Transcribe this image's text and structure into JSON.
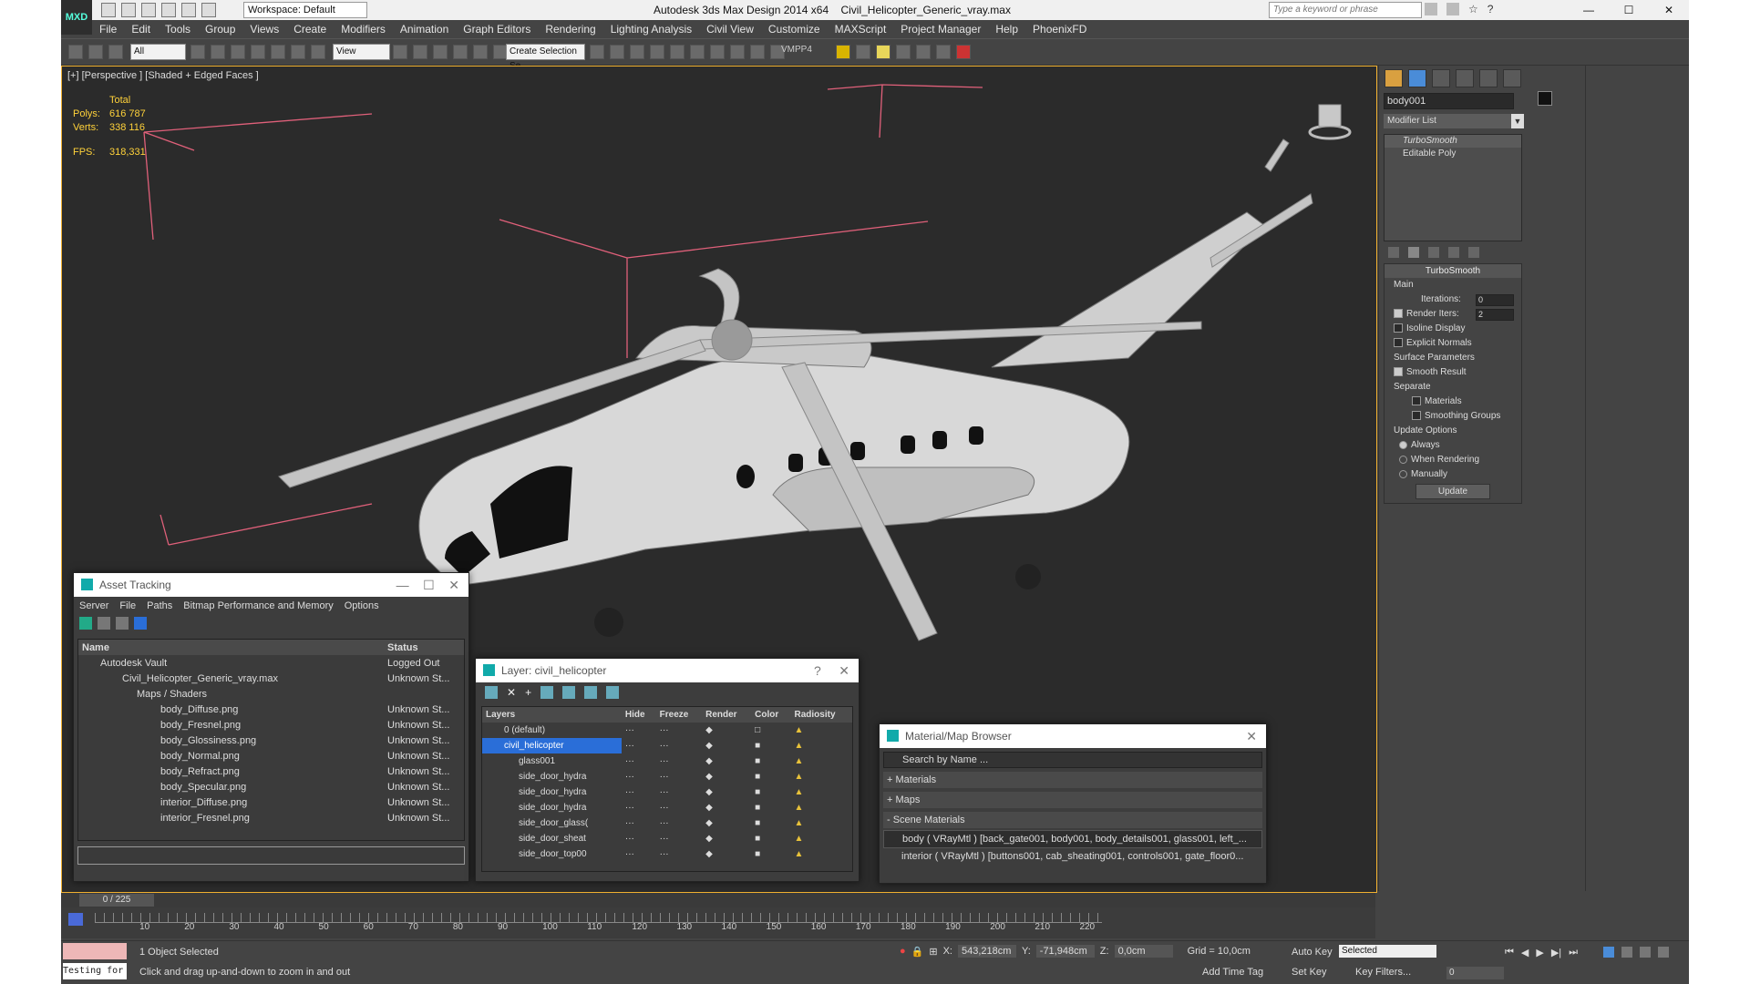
{
  "titlebar": {
    "workspace": "Workspace: Default",
    "app_title": "Autodesk 3ds Max Design 2014 x64",
    "file_name": "Civil_Helicopter_Generic_vray.max",
    "search_placeholder": "Type a keyword or phrase",
    "logo": "MXD"
  },
  "menu": [
    "File",
    "Edit",
    "Tools",
    "Group",
    "Views",
    "Create",
    "Modifiers",
    "Animation",
    "Graph Editors",
    "Rendering",
    "Lighting Analysis",
    "Civil View",
    "Customize",
    "MAXScript",
    "Project Manager",
    "Help",
    "PhoenixFD"
  ],
  "toolbar": {
    "filter": "All",
    "ref_coord": "View",
    "selection_set": "Create Selection Se",
    "vmpp": "VMPP4"
  },
  "viewport": {
    "label": "[+] [Perspective ] [Shaded + Edged Faces ]",
    "stats_header": "Total",
    "polys_label": "Polys:",
    "polys": "616 787",
    "verts_label": "Verts:",
    "verts": "338 116",
    "fps_label": "FPS:",
    "fps": "318,331"
  },
  "command_panel": {
    "object_name": "body001",
    "modifier_list": "Modifier List",
    "stack": [
      "TurboSmooth",
      "Editable Poly"
    ],
    "rollout_title": "TurboSmooth",
    "main_label": "Main",
    "iterations_label": "Iterations:",
    "iterations": "0",
    "render_iters_label": "Render Iters:",
    "render_iters": "2",
    "isoline": "Isoline Display",
    "explicit_normals": "Explicit Normals",
    "surface_params": "Surface Parameters",
    "smooth_result": "Smooth Result",
    "separate": "Separate",
    "materials": "Materials",
    "smoothing_groups": "Smoothing Groups",
    "update_options": "Update Options",
    "always": "Always",
    "when_rendering": "When Rendering",
    "manually": "Manually",
    "update_btn": "Update"
  },
  "asset_tracking": {
    "title": "Asset Tracking",
    "menu": [
      "Server",
      "File",
      "Paths",
      "Bitmap Performance and Memory",
      "Options"
    ],
    "col_name": "Name",
    "col_status": "Status",
    "rows": [
      {
        "name": "Autodesk Vault",
        "status": "Logged Out",
        "indent": 1
      },
      {
        "name": "Civil_Helicopter_Generic_vray.max",
        "status": "Unknown St...",
        "indent": 2
      },
      {
        "name": "Maps / Shaders",
        "status": "",
        "indent": 3
      },
      {
        "name": "body_Diffuse.png",
        "status": "Unknown St...",
        "indent": 4
      },
      {
        "name": "body_Fresnel.png",
        "status": "Unknown St...",
        "indent": 4
      },
      {
        "name": "body_Glossiness.png",
        "status": "Unknown St...",
        "indent": 4
      },
      {
        "name": "body_Normal.png",
        "status": "Unknown St...",
        "indent": 4
      },
      {
        "name": "body_Refract.png",
        "status": "Unknown St...",
        "indent": 4
      },
      {
        "name": "body_Specular.png",
        "status": "Unknown St...",
        "indent": 4
      },
      {
        "name": "interior_Diffuse.png",
        "status": "Unknown St...",
        "indent": 4
      },
      {
        "name": "interior_Fresnel.png",
        "status": "Unknown St...",
        "indent": 4
      }
    ]
  },
  "layer_window": {
    "title": "Layer: civil_helicopter",
    "help": "?",
    "cols": [
      "Layers",
      "Hide",
      "Freeze",
      "Render",
      "Color",
      "Radiosity"
    ],
    "rows": [
      {
        "name": "0 (default)",
        "sel": false
      },
      {
        "name": "civil_helicopter",
        "sel": true
      },
      {
        "name": "glass001",
        "sel": false
      },
      {
        "name": "side_door_hydra",
        "sel": false
      },
      {
        "name": "side_door_hydra",
        "sel": false
      },
      {
        "name": "side_door_hydra",
        "sel": false
      },
      {
        "name": "side_door_glass(",
        "sel": false
      },
      {
        "name": "side_door_sheat",
        "sel": false
      },
      {
        "name": "side_door_top00",
        "sel": false
      }
    ]
  },
  "material_browser": {
    "title": "Material/Map Browser",
    "search": "Search by Name ...",
    "sections": [
      "+ Materials",
      "+ Maps",
      "- Scene Materials"
    ],
    "entries": [
      "body ( VRayMtl ) [back_gate001, body001, body_details001, glass001, left_...",
      "interior ( VRayMtl ) [buttons001, cab_sheating001, controls001, gate_floor0..."
    ]
  },
  "timeline": {
    "frame": "0 / 225",
    "ticks": [
      "10",
      "20",
      "30",
      "40",
      "50",
      "60",
      "70",
      "80",
      "90",
      "100",
      "110",
      "120",
      "130",
      "140",
      "150",
      "160",
      "170",
      "180",
      "190",
      "200",
      "210",
      "220"
    ]
  },
  "status": {
    "maxscript": "Testing for :",
    "selected": "1 Object Selected",
    "prompt": "Click and drag up-and-down to zoom in and out",
    "x_label": "X:",
    "x": "543,218cm",
    "y_label": "Y:",
    "y": "-71,948cm",
    "z_label": "Z:",
    "z": "0,0cm",
    "grid": "Grid = 10,0cm",
    "add_time_tag": "Add Time Tag",
    "auto_key": "Auto Key",
    "set_key": "Set Key",
    "key_mode": "Selected",
    "key_filters": "Key Filters...",
    "frame_field": "0"
  },
  "colors": {
    "accent_yellow": "#ffd23a",
    "viewport_border": "#f0b030",
    "selected_blue": "#2a6ed8"
  }
}
